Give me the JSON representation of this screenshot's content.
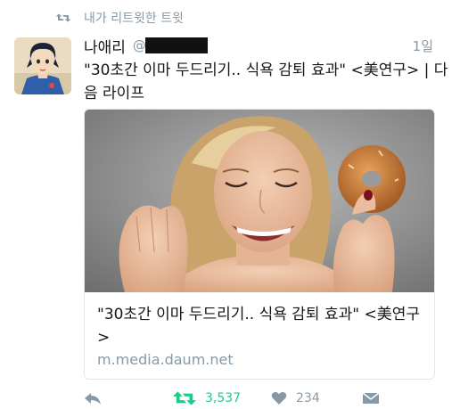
{
  "retweet_context": {
    "label": "내가 리트윗한 트윗",
    "icon": "retweet-icon"
  },
  "tweet": {
    "author_name": "나애리",
    "handle_prefix": "@",
    "timestamp": "1일",
    "text": "\"30초간 이마 두드리기.. 식욕 감퇴 효과\" <美연구> | 다음 라이프"
  },
  "card": {
    "title": "\"30초간 이마 두드리기.. 식욕 감퇴 효과\" <美연구>",
    "domain": "m.media.daum.net"
  },
  "actions": {
    "reply_icon": "reply-icon",
    "retweet_icon": "retweet-icon",
    "retweet_count": "3,537",
    "like_icon": "heart-icon",
    "like_count": "234",
    "message_icon": "message-icon"
  },
  "colors": {
    "retweet_green": "#19cf86",
    "muted_grey": "#8899a6",
    "text": "#14171a",
    "border": "#e1e8ed"
  }
}
